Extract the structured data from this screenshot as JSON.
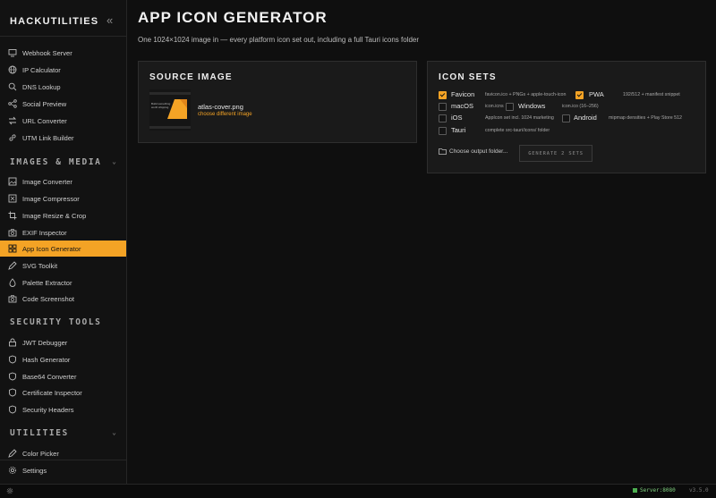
{
  "brand": "HACKUTILITIES",
  "collapse_icon": "double-chevron-left-icon",
  "sidebar": {
    "items_top": [
      {
        "label": "Webhook Server",
        "icon": "monitor-icon"
      },
      {
        "label": "IP Calculator",
        "icon": "globe-icon"
      },
      {
        "label": "DNS Lookup",
        "icon": "search-icon"
      },
      {
        "label": "Social Preview",
        "icon": "share-icon"
      },
      {
        "label": "URL Converter",
        "icon": "swap-icon"
      },
      {
        "label": "UTM Link Builder",
        "icon": "link-icon"
      }
    ],
    "section_images": "IMAGES & MEDIA",
    "items_images": [
      {
        "label": "Image Converter",
        "icon": "image-icon"
      },
      {
        "label": "Image Compressor",
        "icon": "compress-icon"
      },
      {
        "label": "Image Resize & Crop",
        "icon": "crop-icon"
      },
      {
        "label": "EXIF Inspector",
        "icon": "camera-icon"
      },
      {
        "label": "App Icon Generator",
        "icon": "grid-icon",
        "active": true
      },
      {
        "label": "SVG Toolkit",
        "icon": "pen-icon"
      },
      {
        "label": "Palette Extractor",
        "icon": "droplet-icon"
      },
      {
        "label": "Code Screenshot",
        "icon": "camera-icon"
      }
    ],
    "section_security": "SECURITY TOOLS",
    "items_security": [
      {
        "label": "JWT Debugger",
        "icon": "lock-icon"
      },
      {
        "label": "Hash Generator",
        "icon": "shield-icon"
      },
      {
        "label": "Base64 Converter",
        "icon": "shield-icon"
      },
      {
        "label": "Certificate Inspector",
        "icon": "shield-icon"
      },
      {
        "label": "Security Headers",
        "icon": "shield-icon"
      }
    ],
    "section_utilities": "UTILITIES",
    "items_utilities": [
      {
        "label": "Color Picker",
        "icon": "pen-icon"
      }
    ],
    "settings": {
      "label": "Settings",
      "icon": "gear-icon"
    }
  },
  "page": {
    "title": "APP ICON GENERATOR",
    "subtitle": "One 1024×1024 image in — every platform icon set out, including a full Tauri icons folder"
  },
  "source": {
    "title": "SOURCE IMAGE",
    "filename": "atlas-cover.png",
    "change_label": "choose different image",
    "thumb_text": "Build something worth shipping"
  },
  "icon_sets": {
    "title": "ICON SETS",
    "sets": [
      {
        "label": "Favicon",
        "desc": "favicon.ico + PNGs + apple-touch-icon",
        "checked": true
      },
      {
        "label": "PWA",
        "desc": "192/512 + manifest snippet",
        "checked": true
      },
      {
        "label": "macOS",
        "desc": "icon.icns",
        "checked": false
      },
      {
        "label": "Windows",
        "desc": "icon.ico (16–256)",
        "checked": false
      },
      {
        "label": "iOS",
        "desc": "AppIcon set incl. 1024 marketing",
        "checked": false
      },
      {
        "label": "Android",
        "desc": "mipmap densities + Play Store 512",
        "checked": false
      },
      {
        "label": "Tauri",
        "desc": "complete src-tauri/icons/ folder",
        "checked": false
      }
    ],
    "folder_label": "Choose output folder...",
    "generate_label": "GENERATE 2 SETS"
  },
  "status": {
    "server": "Server:8080",
    "version": "v3.5.0"
  },
  "colors": {
    "accent": "#f4a325",
    "background": "#0f0f0f",
    "panel": "#1a1a1a"
  }
}
